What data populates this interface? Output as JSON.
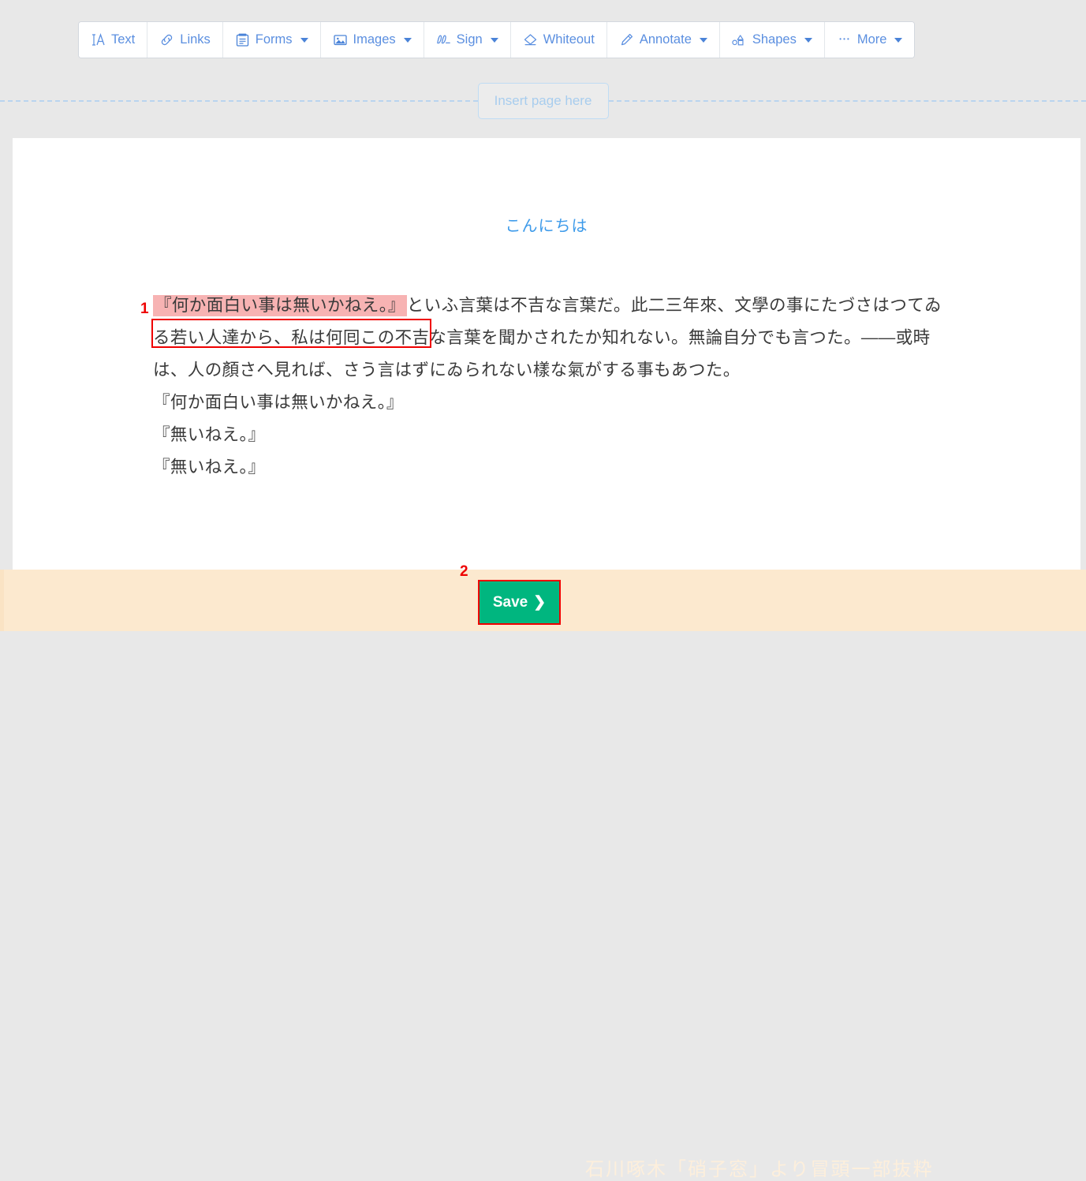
{
  "toolbar": {
    "buttons": [
      {
        "label": "Text",
        "icon": "text-format-icon",
        "caret": false
      },
      {
        "label": "Links",
        "icon": "link-icon",
        "caret": false
      },
      {
        "label": "Forms",
        "icon": "form-icon",
        "caret": true
      },
      {
        "label": "Images",
        "icon": "image-icon",
        "caret": true
      },
      {
        "label": "Sign",
        "icon": "signature-icon",
        "caret": true
      },
      {
        "label": "Whiteout",
        "icon": "eraser-icon",
        "caret": false
      },
      {
        "label": "Annotate",
        "icon": "highlighter-icon",
        "caret": true
      },
      {
        "label": "Shapes",
        "icon": "shapes-icon",
        "caret": true
      },
      {
        "label": "More",
        "icon": "ellipsis-icon",
        "caret": true
      }
    ]
  },
  "insert_page": {
    "label": "Insert page here"
  },
  "document": {
    "title": "こんにちは",
    "highlighted_text": "『何か面白い事は無いかねえ。』",
    "paragraph_rest": "といふ言葉は不吉な言葉だ。此二三年來、文學の事にたづさはつてゐる若い人達から、私は何囘この不吉な言葉を聞かされたか知れない。無論自分でも言つた。――或時は、人の顏さへ見れば、さう言はずにゐられない樣な氣がする事もあつた。",
    "lines": [
      "『何か面白い事は無いかねえ。』",
      "『無いねえ。』",
      "『無いねえ。』"
    ]
  },
  "annotations": {
    "step_1": "1",
    "step_2": "2"
  },
  "bottom_bar": {
    "save_label": "Save",
    "save_chevron": "❯",
    "credit": "石川啄木「硝子窓」より冒頭一部抜粋"
  },
  "colors": {
    "accent_blue": "#5b8fe0",
    "title_blue": "#3e9bea",
    "highlight_pink": "#f7b3b3",
    "annotation_red": "#ef0000",
    "save_green": "#00b67f",
    "bottom_bar_beige": "#fce9cf",
    "page_background": "#e8e8e8"
  }
}
